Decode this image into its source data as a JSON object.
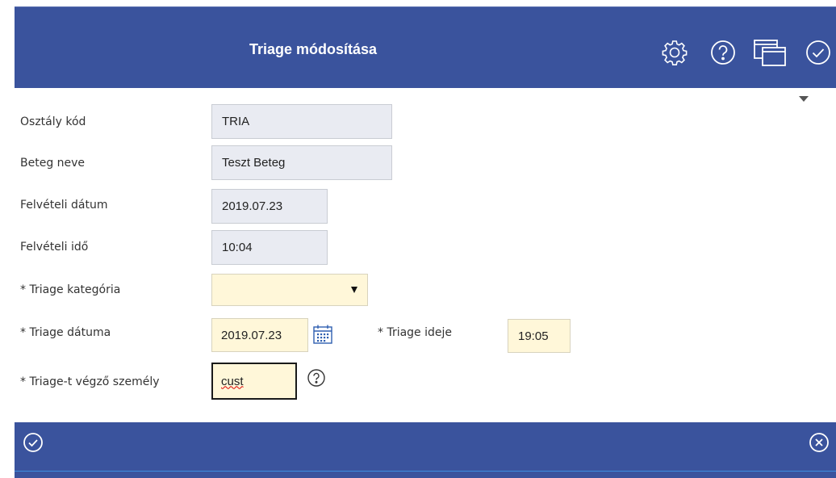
{
  "header": {
    "title": "Triage módosítása",
    "icons": [
      "gear-icon",
      "help-icon",
      "windows-icon",
      "confirm-icon"
    ]
  },
  "form": {
    "department_code": {
      "label": "Osztály kód",
      "value": "TRIA"
    },
    "patient_name": {
      "label": "Beteg neve",
      "value": "Teszt Beteg"
    },
    "admission_date": {
      "label": "Felvételi dátum",
      "value": "2019.07.23"
    },
    "admission_time": {
      "label": "Felvételi idő",
      "value": "10:04"
    },
    "triage_category": {
      "label": "* Triage kategória",
      "value": ""
    },
    "triage_date": {
      "label": "* Triage dátuma",
      "value": "2019.07.23"
    },
    "triage_time": {
      "label": "* Triage ideje",
      "value": "19:05"
    },
    "triage_person": {
      "label": "* Triage-t végző személy",
      "value": "cust"
    }
  },
  "footer": {
    "icons": [
      "confirm-icon",
      "cancel-icon"
    ]
  },
  "colors": {
    "bar": "#3a539d",
    "required_field": "#fff7d9",
    "readonly_field": "#e9ebf2"
  }
}
